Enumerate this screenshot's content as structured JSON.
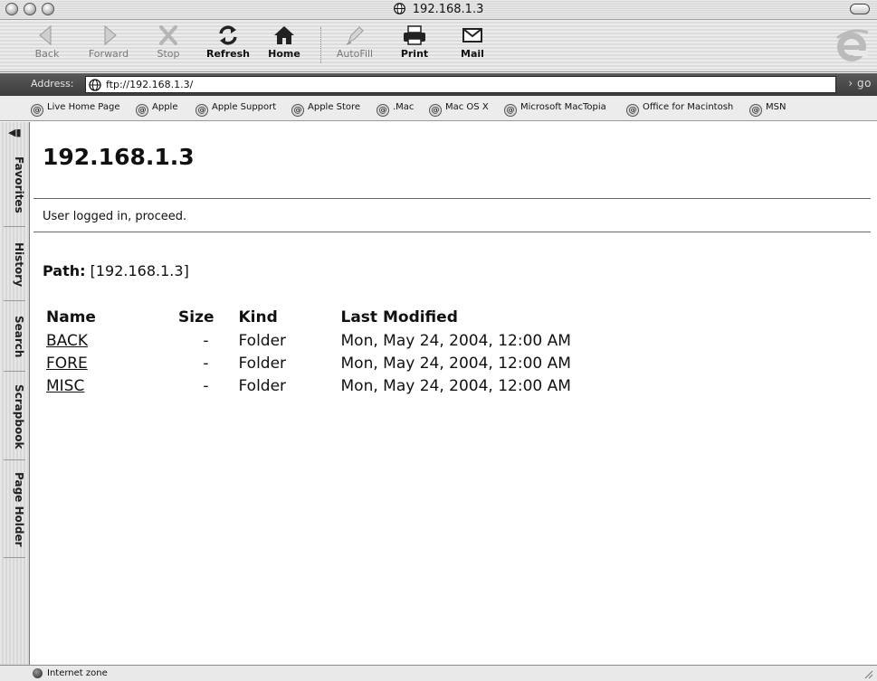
{
  "window": {
    "title": "192.168.1.3"
  },
  "toolbar": {
    "buttons": [
      {
        "label": "Back",
        "icon": "back-arrow-icon",
        "enabled": false
      },
      {
        "label": "Forward",
        "icon": "forward-arrow-icon",
        "enabled": false
      },
      {
        "label": "Stop",
        "icon": "stop-x-icon",
        "enabled": false
      },
      {
        "label": "Refresh",
        "icon": "refresh-icon",
        "enabled": true
      },
      {
        "label": "Home",
        "icon": "home-icon",
        "enabled": true
      },
      {
        "label": "AutoFill",
        "icon": "autofill-pen-icon",
        "enabled": false
      },
      {
        "label": "Print",
        "icon": "printer-icon",
        "enabled": true
      },
      {
        "label": "Mail",
        "icon": "mail-envelope-icon",
        "enabled": true
      }
    ]
  },
  "address": {
    "label": "Address:",
    "value": "ftp://192.168.1.3/",
    "go_label": "› go"
  },
  "favorites": [
    "Live Home Page",
    "Apple",
    "Apple Support",
    "Apple Store",
    ".Mac",
    "Mac OS X",
    "Microsoft MacTopia",
    "Office for Macintosh",
    "MSN"
  ],
  "sidebar": {
    "tabs": [
      "Favorites",
      "History",
      "Search",
      "Scrapbook",
      "Page Holder"
    ]
  },
  "page": {
    "heading": "192.168.1.3",
    "message": "User logged in, proceed.",
    "path_label": "Path:",
    "path_value": "[192.168.1.3]",
    "columns": [
      "Name",
      "Size",
      "Kind",
      "Last Modified"
    ],
    "rows": [
      {
        "name": "BACK",
        "size": "-",
        "kind": "Folder",
        "modified": "Mon, May 24, 2004, 12:00 AM"
      },
      {
        "name": "FORE",
        "size": "-",
        "kind": "Folder",
        "modified": "Mon, May 24, 2004, 12:00 AM"
      },
      {
        "name": "MISC",
        "size": "-",
        "kind": "Folder",
        "modified": "Mon, May 24, 2004, 12:00 AM"
      }
    ]
  },
  "status": {
    "zone": "Internet zone"
  }
}
